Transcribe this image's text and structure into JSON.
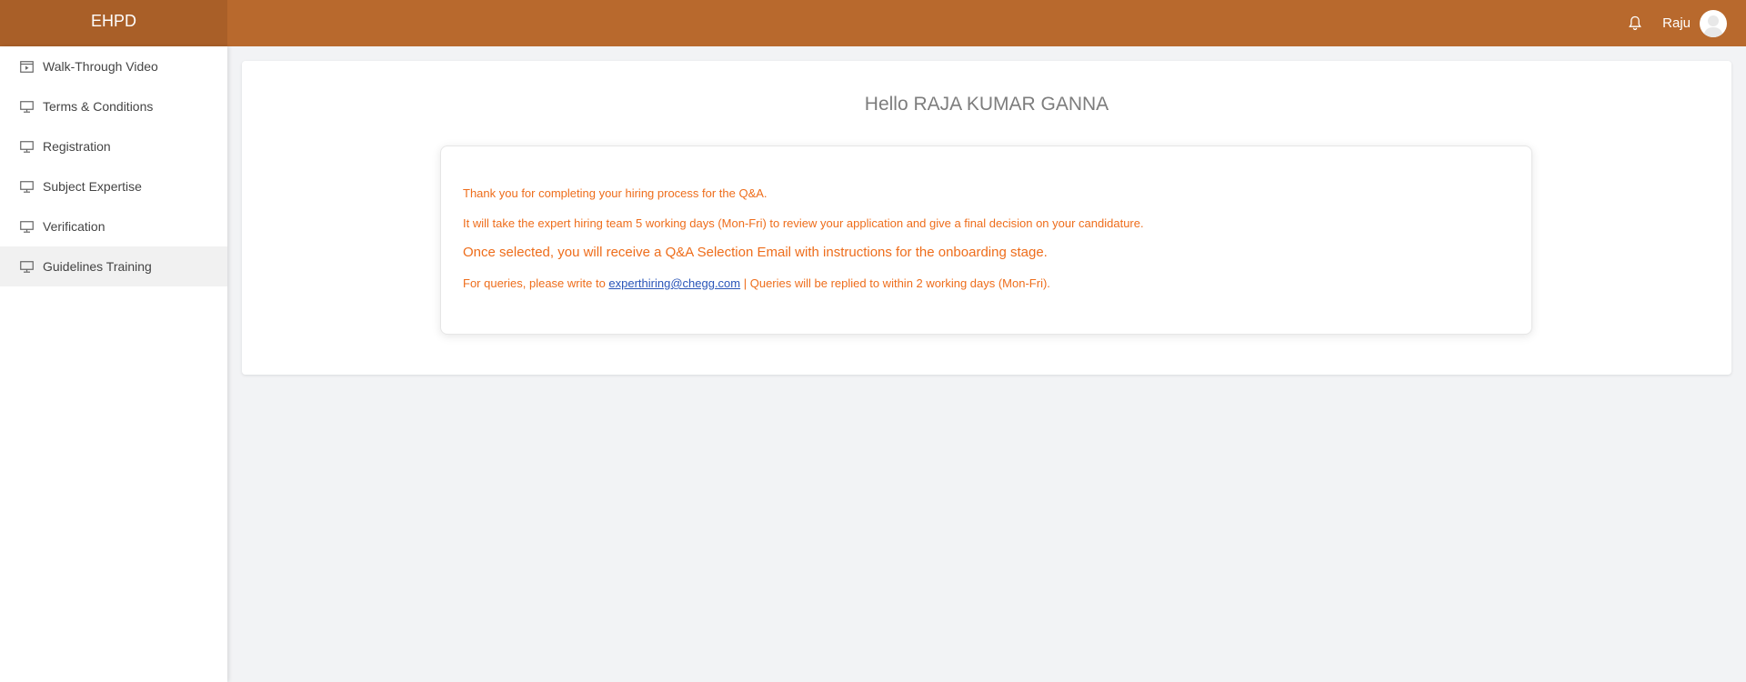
{
  "app": {
    "brand": "EHPD"
  },
  "header": {
    "username": "Raju",
    "icons": {
      "notification": "bell-icon",
      "avatar": "user-avatar"
    }
  },
  "sidebar": {
    "items": [
      {
        "label": "Walk-Through Video",
        "icon": "video-icon",
        "active": false
      },
      {
        "label": "Terms & Conditions",
        "icon": "monitor-icon",
        "active": false
      },
      {
        "label": "Registration",
        "icon": "monitor-icon",
        "active": false
      },
      {
        "label": "Subject Expertise",
        "icon": "monitor-icon",
        "active": false
      },
      {
        "label": "Verification",
        "icon": "monitor-icon",
        "active": false
      },
      {
        "label": "Guidelines Training",
        "icon": "monitor-icon",
        "active": true
      }
    ]
  },
  "main": {
    "greeting": "Hello RAJA KUMAR GANNA",
    "messages": {
      "line1": "Thank you for completing your hiring process for the Q&A.",
      "line2": "It will take the expert hiring team 5 working days (Mon-Fri) to review your application and give a final decision on your candidature.",
      "line3": "Once selected, you will receive a Q&A Selection Email with instructions for the onboarding stage.",
      "line4_prefix": "For queries, please write to ",
      "line4_email": "experthiring@chegg.com",
      "line4_suffix": " | Queries will be replied to within 2 working days (Mon-Fri)."
    }
  },
  "colors": {
    "topbar": "#b8692d",
    "brand_bg": "#a95f28",
    "message_text": "#ee6d1b",
    "link": "#2a55b8"
  }
}
